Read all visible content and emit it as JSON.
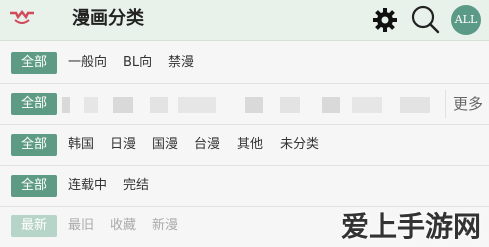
{
  "header": {
    "title": "漫画分类",
    "avatar_text": "ALL",
    "accent": "#5e9b85"
  },
  "rows": [
    {
      "active": "全部",
      "items": [
        "一般向",
        "BL向",
        "禁漫"
      ]
    },
    {
      "active": "全部",
      "more": "更多"
    },
    {
      "active": "全部",
      "items": [
        "韩国",
        "日漫",
        "国漫",
        "台漫",
        "其他",
        "未分类"
      ]
    },
    {
      "active": "全部",
      "items": [
        "连载中",
        "完结"
      ]
    },
    {
      "active": "最新",
      "items": [
        "最旧",
        "收藏",
        "新漫"
      ]
    }
  ],
  "watermark": "爱上手游网",
  "icons": [
    "logo-icon",
    "gear-icon",
    "search-icon"
  ]
}
